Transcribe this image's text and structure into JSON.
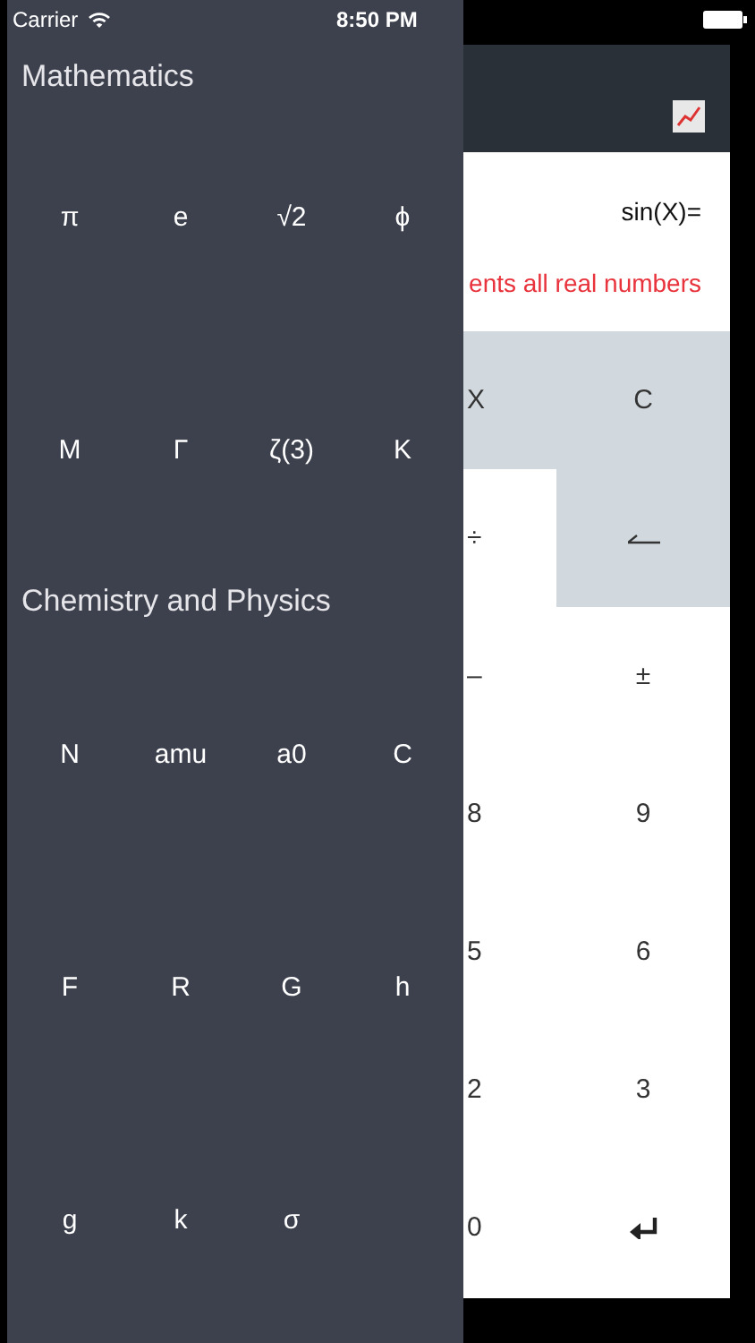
{
  "status_bar": {
    "carrier": "Carrier",
    "time": "8:50 PM"
  },
  "sidebar": {
    "sections": [
      {
        "title": "Mathematics",
        "items": [
          "π",
          "e",
          "√2",
          "ϕ",
          "M",
          "Γ",
          "ζ(3)",
          "K"
        ]
      },
      {
        "title": "Chemistry and Physics",
        "items": [
          "N",
          "amu",
          "a0",
          "C",
          "F",
          "R",
          "G",
          "h",
          "g",
          "k",
          "σ"
        ]
      }
    ]
  },
  "display": {
    "expression": "sin(X)=",
    "message": "ents all real numbers"
  },
  "keypad": {
    "rows": [
      [
        {
          "kind": "text",
          "label": "X",
          "highlighted": true
        },
        {
          "kind": "text",
          "label": "C",
          "highlighted": true
        }
      ],
      [
        {
          "kind": "text",
          "label": "÷",
          "highlighted": false
        },
        {
          "kind": "backspace",
          "highlighted": true
        }
      ],
      [
        {
          "kind": "text",
          "label": "–",
          "highlighted": false
        },
        {
          "kind": "text",
          "label": "±",
          "highlighted": false
        }
      ],
      [
        {
          "kind": "text",
          "label": "8",
          "highlighted": false
        },
        {
          "kind": "text",
          "label": "9",
          "highlighted": false
        }
      ],
      [
        {
          "kind": "text",
          "label": "5",
          "highlighted": false
        },
        {
          "kind": "text",
          "label": "6",
          "highlighted": false
        }
      ],
      [
        {
          "kind": "text",
          "label": "2",
          "highlighted": false
        },
        {
          "kind": "text",
          "label": "3",
          "highlighted": false
        }
      ],
      [
        {
          "kind": "text",
          "label": "0",
          "highlighted": false
        },
        {
          "kind": "enter",
          "highlighted": false
        }
      ]
    ]
  }
}
